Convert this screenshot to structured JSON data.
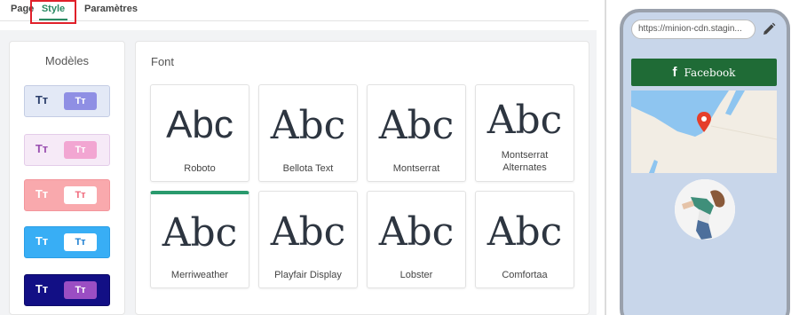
{
  "tabs": [
    {
      "label": "Page"
    },
    {
      "label": "Style"
    },
    {
      "label": "Paramètres"
    }
  ],
  "models": {
    "title": "Modèles",
    "swatches": [
      {
        "left_text": "Tт",
        "right_text": "Tт",
        "bg": "#e3e9f6",
        "left_color": "#2b3e6b",
        "right_bg": "#8f8fe4",
        "right_color": "#ffffff"
      },
      {
        "left_text": "Tт",
        "right_text": "Tт",
        "bg": "#f6eaf7",
        "left_color": "#9a50b0",
        "right_bg": "#f2a6d2",
        "right_color": "#ffffff"
      },
      {
        "left_text": "Tт",
        "right_text": "Tт",
        "bg": "#f9a9ad",
        "left_color": "#ffffff",
        "right_bg": "#ffffff",
        "right_color": "#f06a7c"
      },
      {
        "left_text": "Tт",
        "right_text": "Tт",
        "bg": "#38aef5",
        "left_color": "#ffffff",
        "right_bg": "#ffffff",
        "right_color": "#1d7fd1"
      },
      {
        "left_text": "Tт",
        "right_text": "Tт",
        "bg": "#120f85",
        "left_color": "#ffffff",
        "right_bg": "#9b4ec3",
        "right_color": "#ffffff"
      }
    ]
  },
  "fonts": {
    "title": "Font",
    "sample_text": "Abc",
    "items": [
      {
        "name": "Roboto"
      },
      {
        "name": "Bellota Text"
      },
      {
        "name": "Montserrat"
      },
      {
        "name": "Montserrat Alternates"
      },
      {
        "name": "Merriweather"
      },
      {
        "name": "Playfair Display"
      },
      {
        "name": "Lobster"
      },
      {
        "name": "Comfortaa"
      }
    ],
    "selected": "Merriweather"
  },
  "preview": {
    "url": "https://minion-cdn.stagin...",
    "button_label": "Facebook",
    "button_icon": "facebook-icon",
    "accent": "#1f6b36"
  }
}
